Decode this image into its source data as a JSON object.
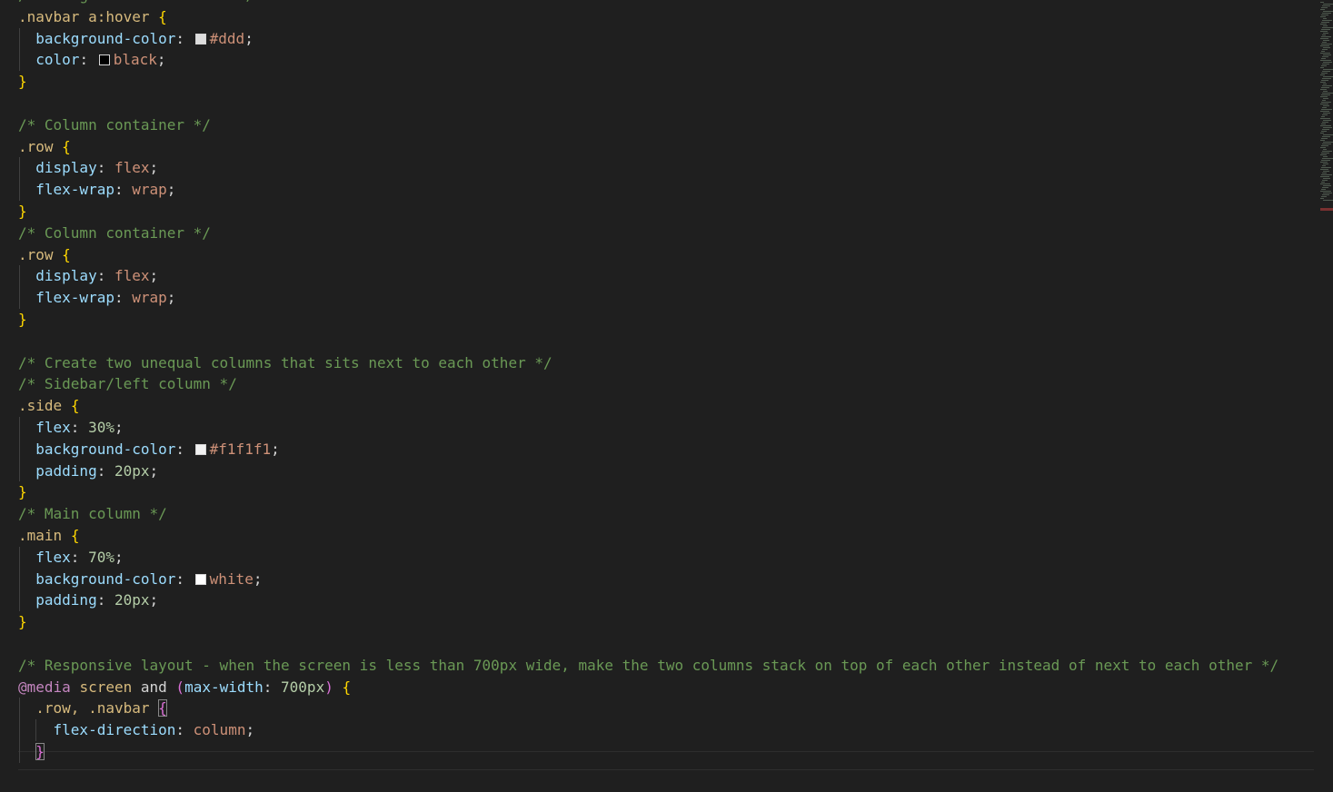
{
  "editor": {
    "lines": [
      {
        "comment": "/* Change color on hover */"
      },
      {
        "selector": ".navbar a:hover"
      },
      {
        "prop": "background-color",
        "swatch": "#dddddd",
        "value": "#ddd"
      },
      {
        "prop": "color",
        "swatch": "#000000",
        "value": "black"
      },
      {
        "close": "}"
      },
      {
        "blank": ""
      },
      {
        "comment": "/* Column container */"
      },
      {
        "selector": ".row"
      },
      {
        "prop": "display",
        "value": "flex"
      },
      {
        "prop": "flex-wrap",
        "value": "wrap"
      },
      {
        "close": "}"
      },
      {
        "comment": "/* Column container */"
      },
      {
        "selector": ".row"
      },
      {
        "prop": "display",
        "value": "flex"
      },
      {
        "prop": "flex-wrap",
        "value": "wrap"
      },
      {
        "close": "}"
      },
      {
        "blank": ""
      },
      {
        "comment": "/* Create two unequal columns that sits next to each other */"
      },
      {
        "comment": "/* Sidebar/left column */"
      },
      {
        "selector": ".side"
      },
      {
        "prop": "flex",
        "num": "30%"
      },
      {
        "prop": "background-color",
        "swatch": "#f1f1f1",
        "value": "#f1f1f1"
      },
      {
        "prop": "padding",
        "num": "20px"
      },
      {
        "close": "}"
      },
      {
        "comment": "/* Main column */"
      },
      {
        "selector": ".main"
      },
      {
        "prop": "flex",
        "num": "70%"
      },
      {
        "prop": "background-color",
        "swatch": "#ffffff",
        "value": "white"
      },
      {
        "prop": "padding",
        "num": "20px"
      },
      {
        "close": "}"
      },
      {
        "blank": ""
      },
      {
        "comment": "/* Responsive layout - when the screen is less than 700px wide, make the two columns stack on top of each other instead of next to each other */"
      },
      {
        "media": true,
        "at": "@media",
        "type": "screen",
        "kw": "and",
        "feature": "max-width",
        "num": "700px"
      },
      {
        "inner_selector": ".row, .navbar"
      },
      {
        "inner_prop": "flex-direction",
        "value": "column"
      },
      {
        "inner_close": "}"
      }
    ]
  }
}
